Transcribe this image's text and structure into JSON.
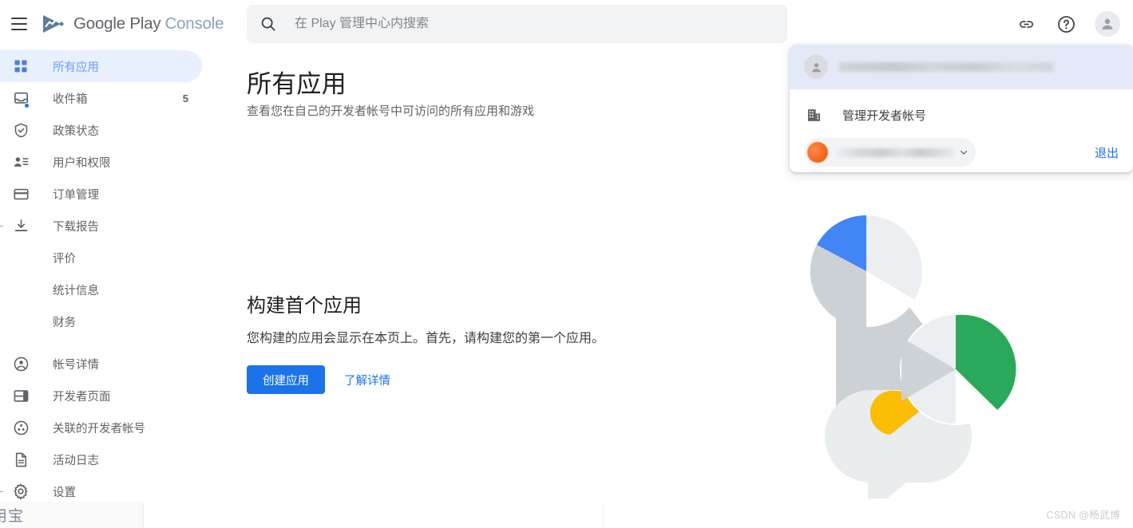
{
  "header": {
    "menu_icon": "hamburger-icon",
    "brand_primary": "Google Play",
    "brand_secondary": "Console",
    "search": {
      "icon": "search-icon",
      "placeholder": "在 Play 管理中心内搜索",
      "value": ""
    },
    "actions": [
      {
        "name": "link-icon",
        "title": "链接"
      },
      {
        "name": "help-icon",
        "title": "帮助"
      },
      {
        "name": "account-avatar",
        "title": "帐号"
      }
    ]
  },
  "sidebar": {
    "items": [
      {
        "label": "所有应用",
        "icon": "apps-grid-icon",
        "selected": true,
        "count": "",
        "sub": false,
        "badge": false,
        "tick": false
      },
      {
        "label": "收件箱",
        "icon": "inbox-icon",
        "selected": false,
        "count": "5",
        "sub": false,
        "badge": true,
        "tick": false
      },
      {
        "label": "政策状态",
        "icon": "shield-check-icon",
        "selected": false,
        "count": "",
        "sub": false,
        "badge": false,
        "tick": false
      },
      {
        "label": "用户和权限",
        "icon": "person-list-icon",
        "selected": false,
        "count": "",
        "sub": false,
        "badge": false,
        "tick": false
      },
      {
        "label": "订单管理",
        "icon": "credit-card-icon",
        "selected": false,
        "count": "",
        "sub": false,
        "badge": false,
        "tick": false
      },
      {
        "label": "下载报告",
        "icon": "download-icon",
        "selected": false,
        "count": "",
        "sub": false,
        "badge": false,
        "tick": true
      },
      {
        "label": "评价",
        "icon": "",
        "selected": false,
        "count": "",
        "sub": true,
        "badge": false,
        "tick": false
      },
      {
        "label": "统计信息",
        "icon": "",
        "selected": false,
        "count": "",
        "sub": true,
        "badge": false,
        "tick": false
      },
      {
        "label": "财务",
        "icon": "",
        "selected": false,
        "count": "",
        "sub": true,
        "badge": false,
        "tick": false
      },
      {
        "label": "帐号详情",
        "icon": "account-circle-icon",
        "selected": false,
        "count": "",
        "sub": false,
        "badge": false,
        "tick": false
      },
      {
        "label": "开发者页面",
        "icon": "web-page-icon",
        "selected": false,
        "count": "",
        "sub": false,
        "badge": false,
        "tick": false
      },
      {
        "label": "关联的开发者帐号",
        "icon": "linked-accounts-icon",
        "selected": false,
        "count": "",
        "sub": false,
        "badge": false,
        "tick": false
      },
      {
        "label": "活动日志",
        "icon": "document-icon",
        "selected": false,
        "count": "",
        "sub": false,
        "badge": false,
        "tick": false
      },
      {
        "label": "设置",
        "icon": "gear-icon",
        "selected": false,
        "count": "",
        "sub": false,
        "badge": false,
        "tick": true
      }
    ]
  },
  "main": {
    "title": "所有应用",
    "subtitle": "查看您在自己的开发者帐号中可访问的所有应用和游戏",
    "empty_state": {
      "title": "构建首个应用",
      "description": "您构建的应用会显示在本页上。首先，请构建您的第一个应用。",
      "primary_button": "创建应用",
      "secondary_link": "了解详情",
      "illustration": "play-console-empty-illustration"
    }
  },
  "account_menu": {
    "header_avatar": "person-avatar-icon",
    "header_account_name": "",
    "manage_item": {
      "icon": "building-icon",
      "label": "管理开发者帐号"
    },
    "account_chip": {
      "avatar": "developer-avatar-orange",
      "name": "",
      "chevron": "chevron-down-icon"
    },
    "signout_label": "退出"
  },
  "overlays": {
    "corner_chip_text": "用宝",
    "watermark": "CSDN @杨武博"
  },
  "colors": {
    "accent_blue": "#1a73e8",
    "selected_pill": "#e8f0fe",
    "illus_blue": "#4285f4",
    "illus_green": "#2ba95b",
    "illus_yellow": "#fbbc04",
    "illus_gray": "#ccd1d6",
    "illus_light": "#eceff1",
    "dropdown_header": "#e3e9f7"
  }
}
